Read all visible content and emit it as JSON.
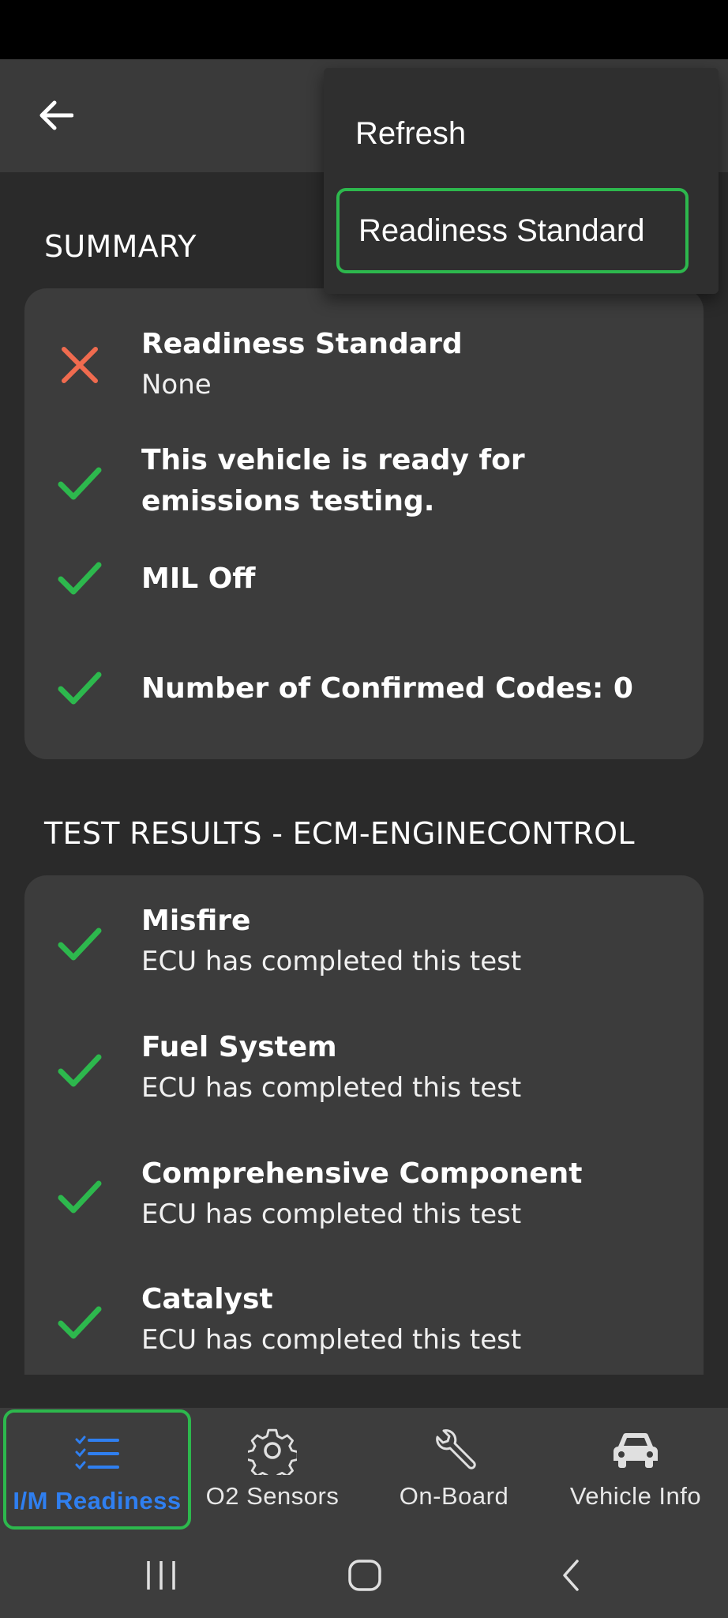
{
  "menu": {
    "refresh_label": "Refresh",
    "readiness_label": "Readiness Standard"
  },
  "summary": {
    "title": "SUMMARY",
    "items": [
      {
        "status": "fail",
        "title": "Readiness Standard",
        "subtitle": "None"
      },
      {
        "status": "pass",
        "title": "This vehicle is ready for emissions testing."
      },
      {
        "status": "pass",
        "title": "MIL Off"
      },
      {
        "status": "pass",
        "title": "Number of Confirmed Codes: 0"
      }
    ]
  },
  "results": {
    "title": "TEST RESULTS - ECM-ENGINECONTROL",
    "items": [
      {
        "status": "pass",
        "title": "Misfire",
        "subtitle": "ECU has completed this test"
      },
      {
        "status": "pass",
        "title": "Fuel System",
        "subtitle": "ECU has completed this test"
      },
      {
        "status": "pass",
        "title": "Comprehensive Component",
        "subtitle": "ECU has completed this test"
      },
      {
        "status": "pass",
        "title": "Catalyst",
        "subtitle": "ECU has completed this test"
      }
    ]
  },
  "bottom_nav": [
    {
      "label": "I/M Readiness",
      "icon": "checklist-icon",
      "active": true
    },
    {
      "label": "O2 Sensors",
      "icon": "gear-icon",
      "active": false
    },
    {
      "label": "On-Board",
      "icon": "wrench-icon",
      "active": false
    },
    {
      "label": "Vehicle Info",
      "icon": "car-icon",
      "active": false
    }
  ],
  "colors": {
    "pass": "#2db84d",
    "fail": "#f06b4f",
    "accent": "#2f7ff0",
    "focus": "#2db84d"
  }
}
